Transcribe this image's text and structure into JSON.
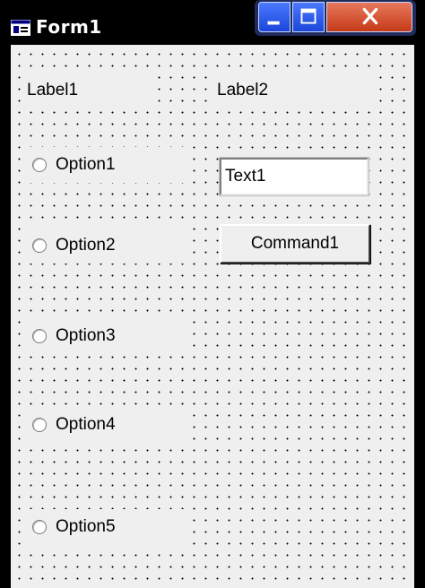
{
  "window": {
    "title": "Form1"
  },
  "labels": {
    "label1": "Label1",
    "label2": "Label2"
  },
  "options": [
    {
      "label": "Option1"
    },
    {
      "label": "Option2"
    },
    {
      "label": "Option3"
    },
    {
      "label": "Option4"
    },
    {
      "label": "Option5"
    }
  ],
  "textbox": {
    "value": "Text1"
  },
  "command": {
    "label": "Command1"
  },
  "icons": {
    "app": "form-app-icon",
    "minimize": "minimize-icon",
    "maximize": "maximize-icon",
    "close": "close-icon"
  },
  "colors": {
    "titlebar": "#000000",
    "client_background": "#efefef",
    "grid_dots": "#000000",
    "control_buttons": "#1a47d8",
    "close_button": "#c43a17"
  }
}
